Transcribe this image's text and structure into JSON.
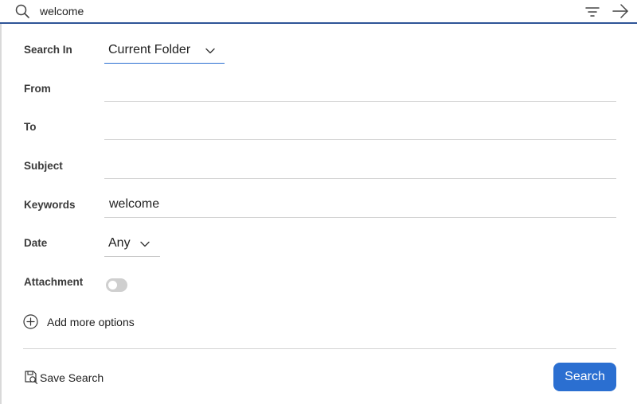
{
  "search_bar": {
    "query": "welcome",
    "icons": [
      "search-icon",
      "filter-icon",
      "arrow-right-icon"
    ]
  },
  "form": {
    "search_in": {
      "label": "Search In",
      "value": "Current Folder"
    },
    "from": {
      "label": "From",
      "value": ""
    },
    "to": {
      "label": "To",
      "value": ""
    },
    "subject": {
      "label": "Subject",
      "value": ""
    },
    "keywords": {
      "label": "Keywords",
      "value": "welcome"
    },
    "date": {
      "label": "Date",
      "value": "Any"
    },
    "attachment": {
      "label": "Attachment",
      "enabled": false
    }
  },
  "add_more_label": "Add more options",
  "footer": {
    "save_label": "Save Search",
    "search_label": "Search"
  },
  "colors": {
    "accent": "#2b6fd1",
    "topbar_border": "#2f5597",
    "toggle_off": "#cfcfcf"
  }
}
